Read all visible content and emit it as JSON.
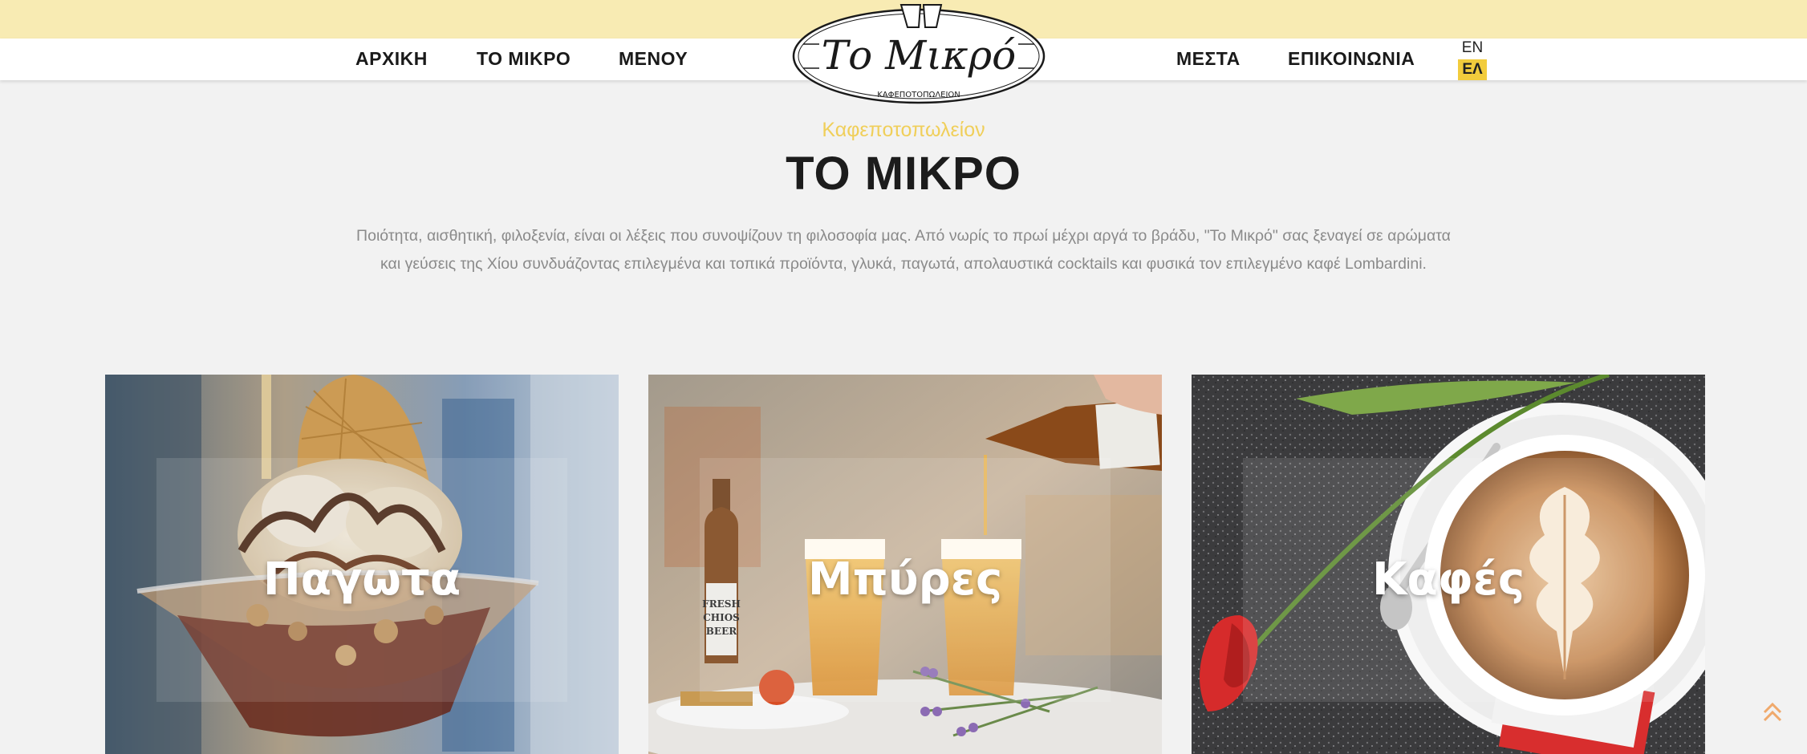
{
  "nav": {
    "left": [
      {
        "label": "ΑΡΧΙΚΗ"
      },
      {
        "label": "ΤΟ ΜΙΚΡΟ"
      },
      {
        "label": "ΜΕΝΟΥ"
      }
    ],
    "right": [
      {
        "label": "ΜΕΣΤΑ"
      },
      {
        "label": "ΕΠΙΚΟΙΝΩΝΙΑ"
      }
    ]
  },
  "logo": {
    "name": "Το Μικρό",
    "tagline": "ΚΑΦΕΠΟΤΟΠΩΛΕΙΟΝ"
  },
  "language": {
    "options": [
      "EN",
      "ΕΛ"
    ],
    "active": "ΕΛ"
  },
  "hero": {
    "subtitle": "Καφεποτοπωλείον",
    "title": "ΤΟ ΜΙΚΡΟ",
    "intro": "Ποιότητα, αισθητική, φιλοξενία, είναι οι λέξεις που συνοψίζουν τη φιλοσοφία μας. Από νωρίς το πρωί μέχρι αργά το βράδυ, \"Το Μικρό\" σας ξεναγεί σε αρώματα και γεύσεις της Χίου συνδυάζοντας επιλεγμένα και τοπικά προϊόντα, γλυκά, παγωτά, απολαυστικά cocktails και φυσικά τον επιλεγμένο καφέ Lombardini."
  },
  "cards": [
    {
      "label": "Παγωτα"
    },
    {
      "label": "Μπύρες"
    },
    {
      "label": "Καφές"
    }
  ],
  "beer_label": {
    "line1": "FRESH",
    "line2": "CHIOS",
    "line3": "BEER"
  },
  "colors": {
    "topbar": "#f8ebb3",
    "accent": "#f0cf5a",
    "active_lang_bg": "#f2cc3c"
  },
  "icons": {
    "scroll_top": "double-chevron-up-icon"
  }
}
